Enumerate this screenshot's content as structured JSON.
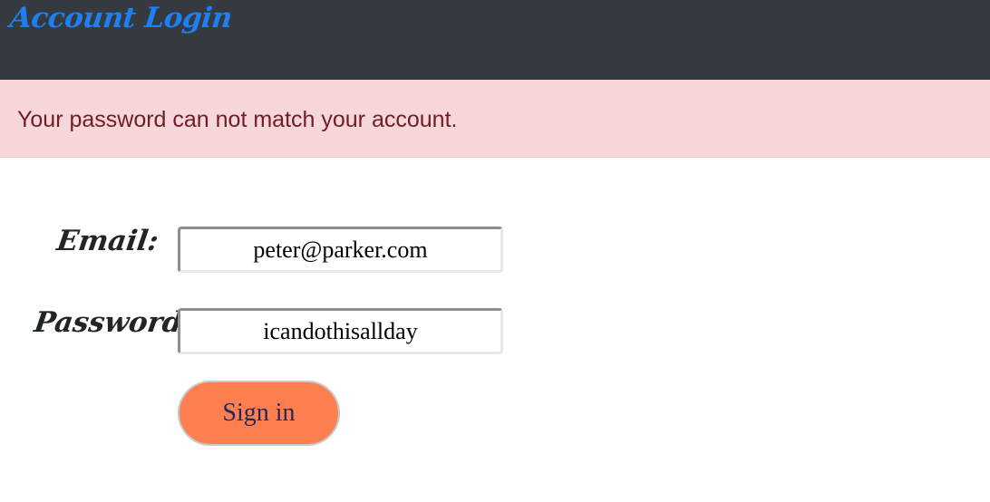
{
  "header": {
    "title": "Account Login",
    "title_color": "#1e7ff0",
    "background": "#343a40"
  },
  "alert": {
    "message": "Your password can not match your account.",
    "background": "#f8d7da",
    "text_color": "#721c24"
  },
  "form": {
    "email": {
      "label": "Email:",
      "value": "peter@parker.com"
    },
    "password": {
      "label": "Password:",
      "value": "icandothisallday"
    },
    "submit_label": "Sign in",
    "submit_color": "#ff7f50"
  }
}
